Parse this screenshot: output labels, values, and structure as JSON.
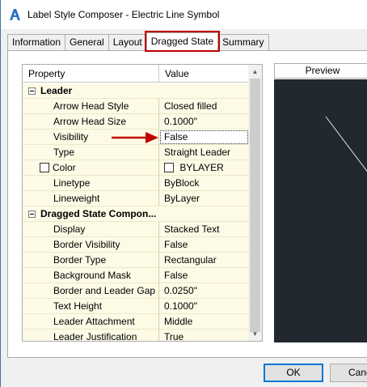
{
  "window": {
    "title": "Label Style Composer - Electric Line Symbol"
  },
  "tabs": [
    {
      "label": "Information"
    },
    {
      "label": "General"
    },
    {
      "label": "Layout"
    },
    {
      "label": "Dragged State",
      "active": true
    },
    {
      "label": "Summary"
    }
  ],
  "grid": {
    "header": {
      "property": "Property",
      "value": "Value"
    },
    "groups": [
      {
        "name": "Leader",
        "rows": [
          {
            "property": "Arrow Head Style",
            "value": "Closed filled"
          },
          {
            "property": "Arrow Head Size",
            "value": "0.1000\""
          },
          {
            "property": "Visibility",
            "value": "False"
          },
          {
            "property": "Type",
            "value": "Straight Leader"
          },
          {
            "property": "Color",
            "value": "BYLAYER"
          },
          {
            "property": "Linetype",
            "value": "ByBlock"
          },
          {
            "property": "Lineweight",
            "value": "ByLayer"
          }
        ]
      },
      {
        "name": "Dragged State Compon...",
        "rows": [
          {
            "property": "Display",
            "value": "Stacked Text"
          },
          {
            "property": "Border Visibility",
            "value": "False"
          },
          {
            "property": "Border Type",
            "value": "Rectangular"
          },
          {
            "property": "Background Mask",
            "value": "False"
          },
          {
            "property": "Border and Leader Gap",
            "value": "0.0250\""
          },
          {
            "property": "Text Height",
            "value": "0.1000\""
          },
          {
            "property": "Leader Attachment",
            "value": "Middle"
          },
          {
            "property": "Leader Justification",
            "value": "True"
          }
        ]
      }
    ]
  },
  "preview": {
    "label": "Preview"
  },
  "buttons": {
    "ok": "OK",
    "cancel": "Cancel"
  },
  "colors": {
    "highlight": "#c00000",
    "grid_background": "#fdfbe6",
    "preview_background": "#212830"
  }
}
